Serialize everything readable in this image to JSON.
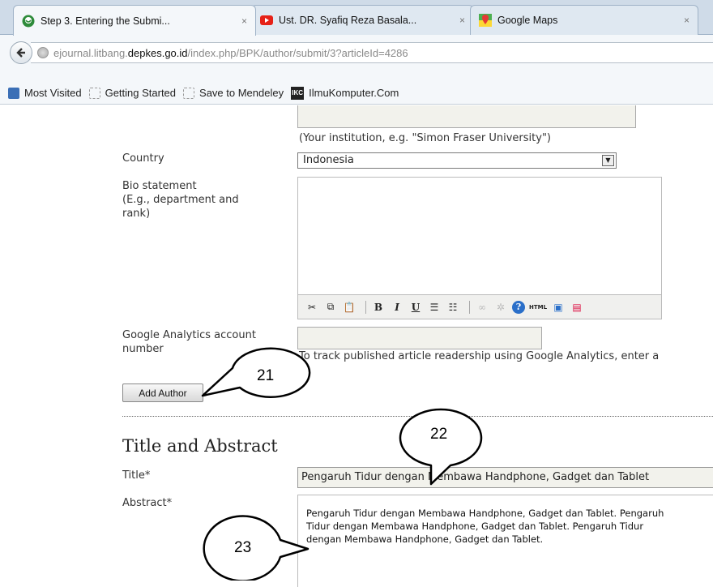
{
  "browser": {
    "tabs": [
      {
        "label": "Step 3. Entering the Submi...",
        "active": true,
        "icon": "site-favicon"
      },
      {
        "label": "Ust. DR. Syafiq Reza Basala...",
        "active": false,
        "icon": "youtube-icon"
      },
      {
        "label": "Google Maps",
        "active": false,
        "icon": "google-maps-icon"
      }
    ],
    "close_glyph": "×",
    "url_prefix": "ejournal.litbang.",
    "url_domain": "depkes.go.id",
    "url_path": "/index.php/BPK/author/submit/3?articleId=4286",
    "bookmarks": [
      {
        "label": "Most Visited",
        "icon": "most-visited-icon"
      },
      {
        "label": "Getting Started",
        "icon": "folder-icon"
      },
      {
        "label": "Save to Mendeley",
        "icon": "folder-icon"
      },
      {
        "label": "IlmuKomputer.Com",
        "icon": "ikc-icon"
      }
    ]
  },
  "form": {
    "affiliation_hint": "(Your institution, e.g. \"Simon Fraser University\")",
    "country_label": "Country",
    "country_value": "Indonesia",
    "bio_label_1": "Bio statement",
    "bio_label_2": "(E.g., department and",
    "bio_label_3": "rank)",
    "ga_label_1": "Google Analytics account",
    "ga_label_2": "number",
    "ga_hint": "To track published article readership using Google Analytics, enter a",
    "add_author_label": "Add Author",
    "section_title": "Title and Abstract",
    "title_label": "Title*",
    "title_value": "Pengaruh Tidur dengan Membawa Handphone, Gadget dan Tablet",
    "abstract_label": "Abstract*",
    "abstract_value": "Pengaruh Tidur dengan Membawa Handphone, Gadget dan Tablet. Pengaruh\nTidur dengan Membawa Handphone, Gadget dan Tablet. Pengaruh Tidur\ndengan Membawa Handphone, Gadget dan Tablet."
  },
  "editor_toolbar": [
    "cut-icon",
    "copy-icon",
    "paste-icon",
    "bold-icon",
    "italic-icon",
    "underline-icon",
    "bullet-list-icon",
    "numbered-list-icon",
    "link-icon",
    "unlink-icon",
    "help-icon",
    "html-icon",
    "fullscreen-icon",
    "image-icon"
  ],
  "toolbar_glyphs": {
    "bold": "B",
    "italic": "I",
    "underline": "U",
    "help": "?",
    "html": "HTML"
  },
  "callouts": [
    "21",
    "22",
    "23"
  ]
}
